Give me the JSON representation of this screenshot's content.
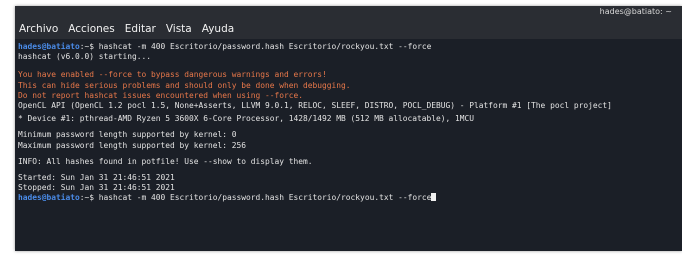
{
  "window": {
    "title": "hades@batiato: ~"
  },
  "menubar": {
    "items": [
      "Archivo",
      "Acciones",
      "Editar",
      "Vista",
      "Ayuda"
    ]
  },
  "colors": {
    "background": "#1b1f27",
    "prompt": "#4a8be8",
    "warning": "#e8784a",
    "text": "#e3e3e3"
  },
  "terminal": {
    "prompt_user": "hades@batiato",
    "prompt_path": ":~$ ",
    "command1": "hashcat -m 400 Escritorio/password.hash Escritorio/rockyou.txt --force",
    "version_line": "hashcat (v6.0.0) starting...",
    "warnings": [
      "You have enabled --force to bypass dangerous warnings and errors!",
      "This can hide serious problems and should only be done when debugging.",
      "Do not report hashcat issues encountered when using --force."
    ],
    "opencl_line": "OpenCL API (OpenCL 1.2 pocl 1.5, None+Asserts, LLVM 9.0.1, RELOC, SLEEF, DISTRO, POCL_DEBUG) - Platform #1 [The pocl project]",
    "device_line": "* Device #1: pthread-AMD Ryzen 5 3600X 6-Core Processor, 1428/1492 MB (512 MB allocatable), 1MCU",
    "min_pw_line": "Minimum password length supported by kernel: 0",
    "max_pw_line": "Maximum password length supported by kernel: 256",
    "info_line": "INFO: All hashes found in potfile! Use --show to display them.",
    "started_line": "Started: Sun Jan 31 21:46:51 2021",
    "stopped_line": "Stopped: Sun Jan 31 21:46:51 2021",
    "command2": "hashcat -m 400 Escritorio/password.hash Escritorio/rockyou.txt --force"
  }
}
